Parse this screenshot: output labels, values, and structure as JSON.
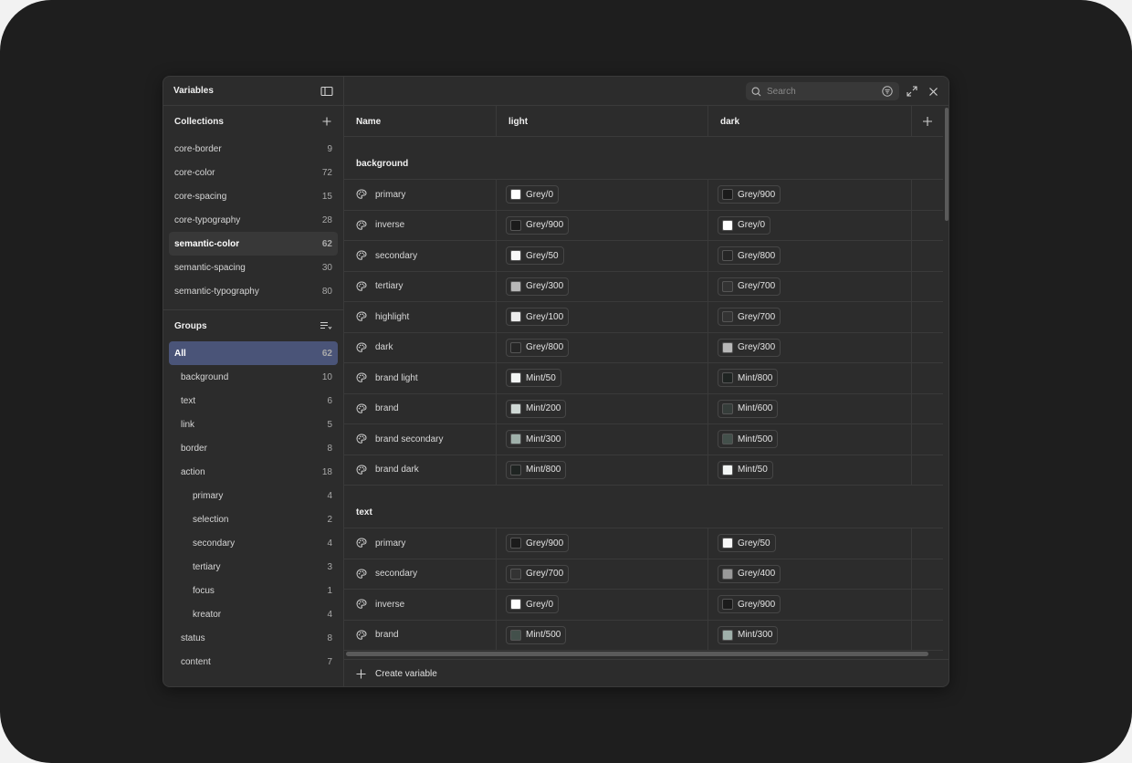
{
  "sidebar": {
    "title": "Variables",
    "collections_title": "Collections",
    "collections": [
      {
        "label": "core-border",
        "count": "9"
      },
      {
        "label": "core-color",
        "count": "72"
      },
      {
        "label": "core-spacing",
        "count": "15"
      },
      {
        "label": "core-typography",
        "count": "28"
      },
      {
        "label": "semantic-color",
        "count": "62"
      },
      {
        "label": "semantic-spacing",
        "count": "30"
      },
      {
        "label": "semantic-typography",
        "count": "80"
      }
    ],
    "groups_title": "Groups",
    "groups": [
      {
        "label": "All",
        "count": "62"
      },
      {
        "label": "background",
        "count": "10"
      },
      {
        "label": "text",
        "count": "6"
      },
      {
        "label": "link",
        "count": "5"
      },
      {
        "label": "border",
        "count": "8"
      },
      {
        "label": "action",
        "count": "18"
      },
      {
        "label": "primary",
        "count": "4"
      },
      {
        "label": "selection",
        "count": "2"
      },
      {
        "label": "secondary",
        "count": "4"
      },
      {
        "label": "tertiary",
        "count": "3"
      },
      {
        "label": "focus",
        "count": "1"
      },
      {
        "label": "kreator",
        "count": "4"
      },
      {
        "label": "status",
        "count": "8"
      },
      {
        "label": "content",
        "count": "7"
      }
    ]
  },
  "search": {
    "placeholder": "Search"
  },
  "table": {
    "headers": {
      "name": "Name",
      "light": "light",
      "dark": "dark"
    },
    "groups": [
      {
        "name": "background",
        "rows": [
          {
            "name": "primary",
            "light": "Grey/0",
            "light_color": "#ffffff",
            "dark": "Grey/900",
            "dark_color": "#1b1b1b"
          },
          {
            "name": "inverse",
            "light": "Grey/900",
            "light_color": "#1b1b1b",
            "dark": "Grey/0",
            "dark_color": "#ffffff"
          },
          {
            "name": "secondary",
            "light": "Grey/50",
            "light_color": "#f7f7f7",
            "dark": "Grey/800",
            "dark_color": "#262626"
          },
          {
            "name": "tertiary",
            "light": "Grey/300",
            "light_color": "#b8b8b8",
            "dark": "Grey/700",
            "dark_color": "#333333"
          },
          {
            "name": "highlight",
            "light": "Grey/100",
            "light_color": "#ececec",
            "dark": "Grey/700",
            "dark_color": "#333333"
          },
          {
            "name": "dark",
            "light": "Grey/800",
            "light_color": "#262626",
            "dark": "Grey/300",
            "dark_color": "#b8b8b8"
          },
          {
            "name": "brand light",
            "light": "Mint/50",
            "light_color": "#f2f5f4",
            "dark": "Mint/800",
            "dark_color": "#1f2422"
          },
          {
            "name": "brand",
            "light": "Mint/200",
            "light_color": "#cfd8d5",
            "dark": "Mint/600",
            "dark_color": "#353d3a"
          },
          {
            "name": "brand secondary",
            "light": "Mint/300",
            "light_color": "#9fb0aa",
            "dark": "Mint/500",
            "dark_color": "#43504b"
          },
          {
            "name": "brand dark",
            "light": "Mint/800",
            "light_color": "#1f2422",
            "dark": "Mint/50",
            "dark_color": "#f2f5f4"
          }
        ]
      },
      {
        "name": "text",
        "rows": [
          {
            "name": "primary",
            "light": "Grey/900",
            "light_color": "#1b1b1b",
            "dark": "Grey/50",
            "dark_color": "#f7f7f7"
          },
          {
            "name": "secondary",
            "light": "Grey/700",
            "light_color": "#333333",
            "dark": "Grey/400",
            "dark_color": "#9a9a9a"
          },
          {
            "name": "inverse",
            "light": "Grey/0",
            "light_color": "#ffffff",
            "dark": "Grey/900",
            "dark_color": "#1b1b1b"
          },
          {
            "name": "brand",
            "light": "Mint/500",
            "light_color": "#43504b",
            "dark": "Mint/300",
            "dark_color": "#9fb0aa"
          }
        ]
      }
    ]
  },
  "footer": {
    "create_label": "Create variable"
  }
}
